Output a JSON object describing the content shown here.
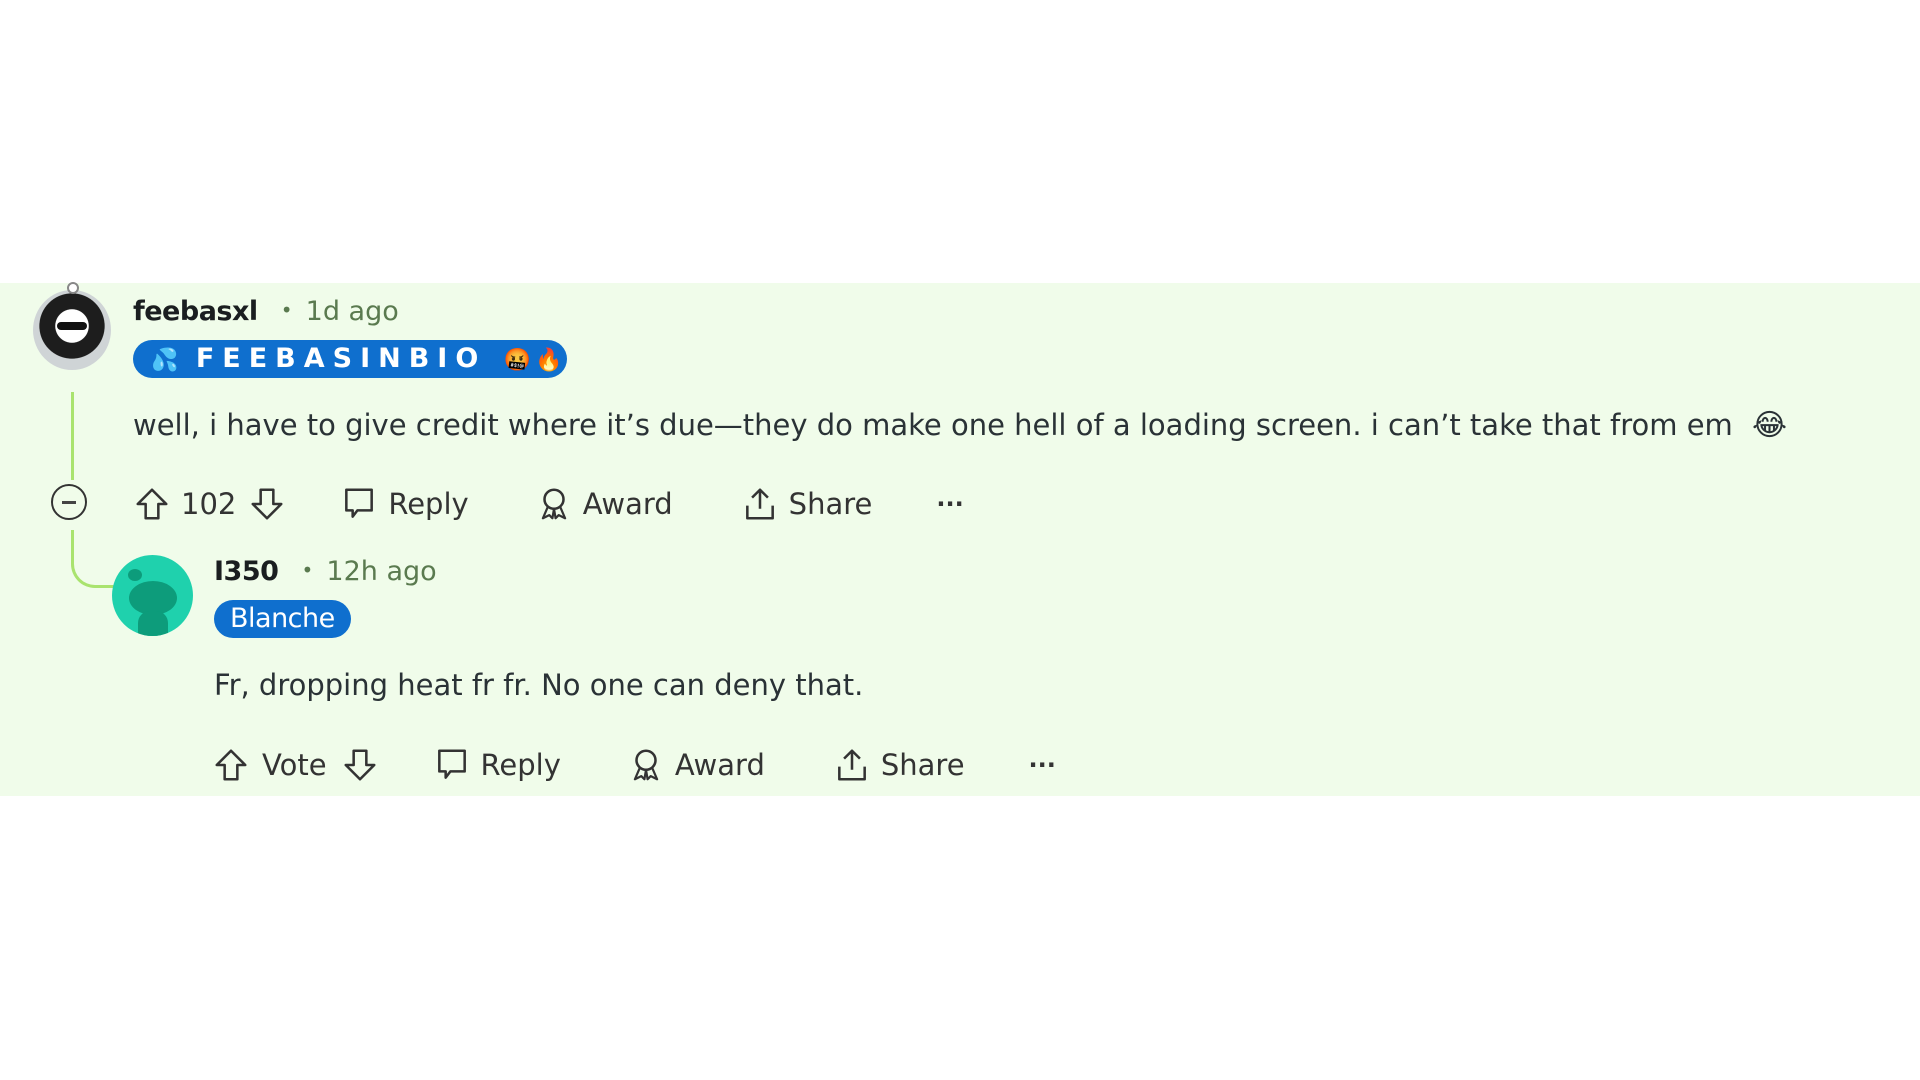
{
  "comments": [
    {
      "username": "feebasxl",
      "separator": "•",
      "time": "1d ago",
      "flair": {
        "prefix_emoji": "💦",
        "text": "FEEBASINBIO",
        "suffix_emojis": "🤬🔥",
        "color": "#0f6fce"
      },
      "body": "well, i have to give credit where it’s due—they do make one hell of a loading screen. i can’t take that from em",
      "body_emoji": "😂",
      "actions": {
        "score": "102",
        "reply": "Reply",
        "award": "Award",
        "share": "Share",
        "more": "···"
      }
    },
    {
      "username": "I350",
      "separator": "•",
      "time": "12h ago",
      "flair": {
        "text": "Blanche",
        "color": "#0f6fce"
      },
      "body": "Fr, dropping heat fr fr. No one can deny that.",
      "actions": {
        "score": "Vote",
        "reply": "Reply",
        "award": "Award",
        "share": "Share",
        "more": "···"
      }
    }
  ],
  "colors": {
    "thread_background": "#f0fcea",
    "thread_line": "#a9e36e",
    "timestamp": "#5a7a4f"
  }
}
